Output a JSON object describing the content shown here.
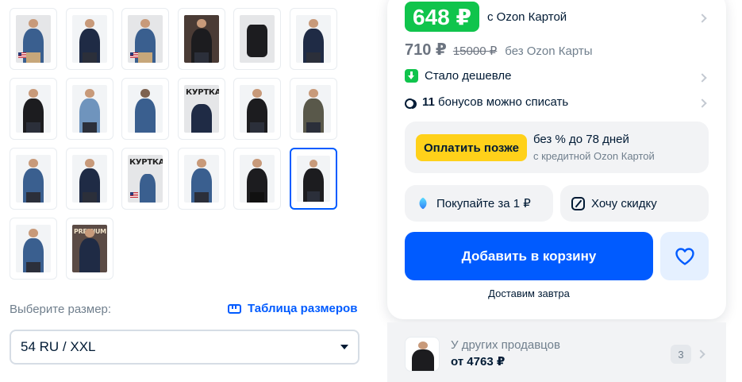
{
  "gallery": {
    "thumbnails": [
      {
        "style": "denim-sand",
        "selected": false
      },
      {
        "style": "navy-dark",
        "selected": false
      },
      {
        "style": "denim-sand",
        "selected": false
      },
      {
        "style": "olive-dark-bg",
        "selected": false
      },
      {
        "style": "flatlay-black",
        "selected": false
      },
      {
        "style": "navy-dark",
        "selected": false
      },
      {
        "style": "black",
        "selected": false
      },
      {
        "style": "light-denim",
        "selected": false
      },
      {
        "style": "denim-back",
        "selected": false
      },
      {
        "style": "poster-navy",
        "selected": false
      },
      {
        "style": "black",
        "selected": false
      },
      {
        "style": "olive",
        "selected": false
      },
      {
        "style": "denim",
        "selected": false
      },
      {
        "style": "navy",
        "selected": false
      },
      {
        "style": "poster-denim",
        "selected": false
      },
      {
        "style": "denim",
        "selected": false
      },
      {
        "style": "black-full",
        "selected": false
      },
      {
        "style": "black",
        "selected": true
      },
      {
        "style": "denim",
        "selected": false
      },
      {
        "style": "premium-city",
        "selected": false
      }
    ],
    "poster_text": "КУРТКА",
    "premium_text": "PREMIUM"
  },
  "size": {
    "label": "Выберите размер:",
    "table_link": "Таблица размеров",
    "selected": "54 RU / XXL"
  },
  "price": {
    "ozon_card_price": "648 ₽",
    "ozon_card_label": "с Ozon Картой",
    "regular_price": "710 ₽",
    "old_price": "15000 ₽",
    "regular_label": "без Ozon Карты",
    "cheaper_label": "Стало дешевле",
    "bonus_count": "11",
    "bonus_label": "бонусов можно списать"
  },
  "pay_later": {
    "button": "Оплатить позже",
    "title": "без % до 78 дней",
    "subtitle": "с кредитной Ozon Картой"
  },
  "actions": {
    "buy_for_1": "Покупайте за 1 ₽",
    "want_discount": "Хочу скидку",
    "add_to_cart": "Добавить в корзину",
    "delivery": "Доставим завтра"
  },
  "other_sellers": {
    "title": "У других продавцов",
    "price": "от 4763 ₽",
    "count": "3"
  },
  "colors": {
    "accent": "#005bff",
    "price_green": "#10c44c",
    "pay_later_yellow": "#ffd11a"
  }
}
